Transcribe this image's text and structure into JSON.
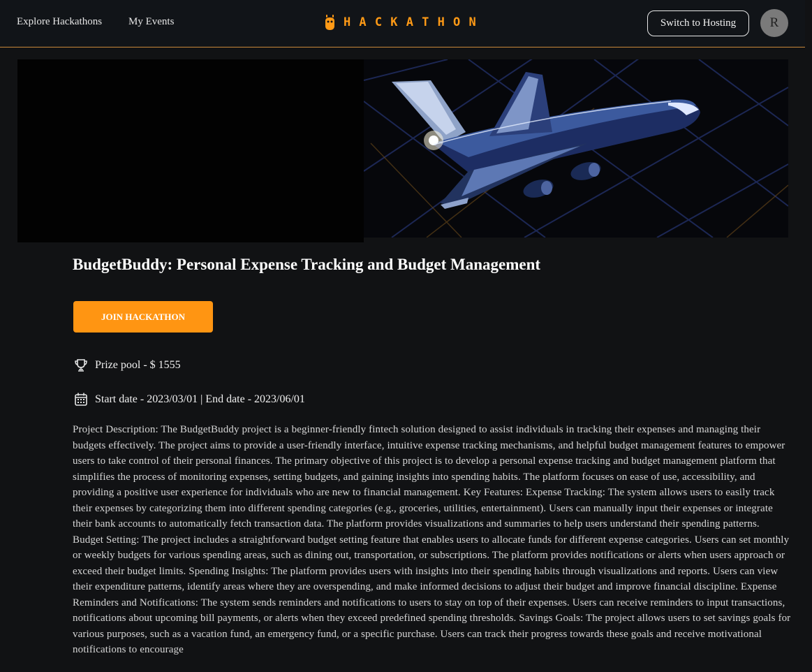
{
  "nav": {
    "explore_label": "Explore Hackathons",
    "events_label": "My Events",
    "logo_text": "HACKATHON",
    "switch_label": "Switch to Hosting",
    "avatar_initial": "R"
  },
  "colors": {
    "accent": "#ff9512",
    "background": "#111214",
    "navbar_border": "#c8893a"
  },
  "banner": {
    "image": "airplane-illustration"
  },
  "hackathon": {
    "title": "BudgetBuddy: Personal Expense Tracking and Budget Management",
    "join_label": "JOIN HACKATHON",
    "prize": "Prize pool - $ 1555",
    "dates": "Start date - 2023/03/01 | End date - 2023/06/01",
    "description": "Project Description: The BudgetBuddy project is a beginner-friendly fintech solution designed to assist individuals in tracking their expenses and managing their budgets effectively. The project aims to provide a user-friendly interface, intuitive expense tracking mechanisms, and helpful budget management features to empower users to take control of their personal finances. The primary objective of this project is to develop a personal expense tracking and budget management platform that simplifies the process of monitoring expenses, setting budgets, and gaining insights into spending habits. The platform focuses on ease of use, accessibility, and providing a positive user experience for individuals who are new to financial management. Key Features: Expense Tracking: The system allows users to easily track their expenses by categorizing them into different spending categories (e.g., groceries, utilities, entertainment). Users can manually input their expenses or integrate their bank accounts to automatically fetch transaction data. The platform provides visualizations and summaries to help users understand their spending patterns. Budget Setting: The project includes a straightforward budget setting feature that enables users to allocate funds for different expense categories. Users can set monthly or weekly budgets for various spending areas, such as dining out, transportation, or subscriptions. The platform provides notifications or alerts when users approach or exceed their budget limits. Spending Insights: The platform provides users with insights into their spending habits through visualizations and reports. Users can view their expenditure patterns, identify areas where they are overspending, and make informed decisions to adjust their budget and improve financial discipline. Expense Reminders and Notifications: The system sends reminders and notifications to users to stay on top of their expenses. Users can receive reminders to input transactions, notifications about upcoming bill payments, or alerts when they exceed predefined spending thresholds. Savings Goals: The project allows users to set savings goals for various purposes, such as a vacation fund, an emergency fund, or a specific purchase. Users can track their progress towards these goals and receive motivational notifications to encourage"
  }
}
